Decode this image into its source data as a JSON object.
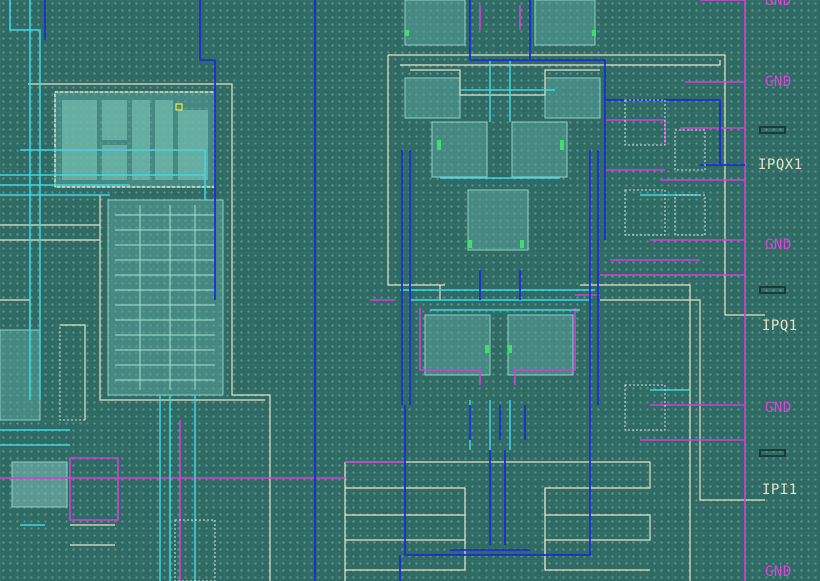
{
  "pin_labels": {
    "gnd_1": "GND",
    "gnd_2": "GND",
    "ipqx1": "IPQX1",
    "gnd_3": "GND",
    "ipq1": "IPQ1",
    "gnd_4": "GND",
    "ipi1": "IPI1",
    "gnd_5": "GND"
  },
  "colors": {
    "substrate": "#2f6b64",
    "metal_blue": "#1a2fd0",
    "metal_cyan": "#3fd8e8",
    "metal_magenta": "#d040d8",
    "outline_cream": "#e8e4c8",
    "poly_green": "#3ee06a",
    "gnd_label": "#e040e0",
    "signal_label": "#e8e4c8"
  }
}
